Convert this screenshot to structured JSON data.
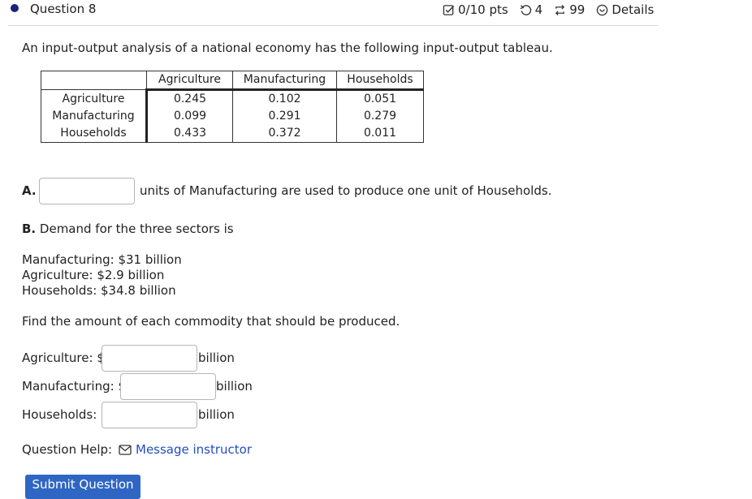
{
  "header": {
    "title": "Question 8",
    "score": "0/10 pts",
    "retries": "4",
    "attempts": "99",
    "details": "Details"
  },
  "intro": "An input-output analysis of a national economy has the following input-output tableau.",
  "tableau": {
    "columns": [
      "Agriculture",
      "Manufacturing",
      "Households"
    ],
    "rows": [
      {
        "label": "Agriculture",
        "values": [
          "0.245",
          "0.102",
          "0.051"
        ]
      },
      {
        "label": "Manufacturing",
        "values": [
          "0.099",
          "0.291",
          "0.279"
        ]
      },
      {
        "label": "Households",
        "values": [
          "0.433",
          "0.372",
          "0.011"
        ]
      }
    ]
  },
  "partA": {
    "label": "A.",
    "input_value": "",
    "text": "units of Manufacturing are used to produce one unit of Households."
  },
  "partB": {
    "label": "B.",
    "text": " Demand for the three sectors is",
    "demands": [
      "Manufacturing: $31 billion",
      "Agriculture: $2.9 billion",
      "Households: $34.8 billion"
    ],
    "find": "Find the amount of each commodity that should be produced.",
    "answers": [
      {
        "label": "Agriculture: $",
        "value": "",
        "unit": "billion"
      },
      {
        "label": "Manufacturing: $",
        "value": "",
        "unit": "billion"
      },
      {
        "label": "Households: $",
        "value": "",
        "unit": "billion"
      }
    ]
  },
  "help": {
    "label": "Question Help:",
    "link": "Message instructor"
  },
  "submit_label": "Submit Question",
  "colors": {
    "accent": "#2f66c4",
    "link": "#1f4fbf",
    "dot": "#1a237e"
  }
}
